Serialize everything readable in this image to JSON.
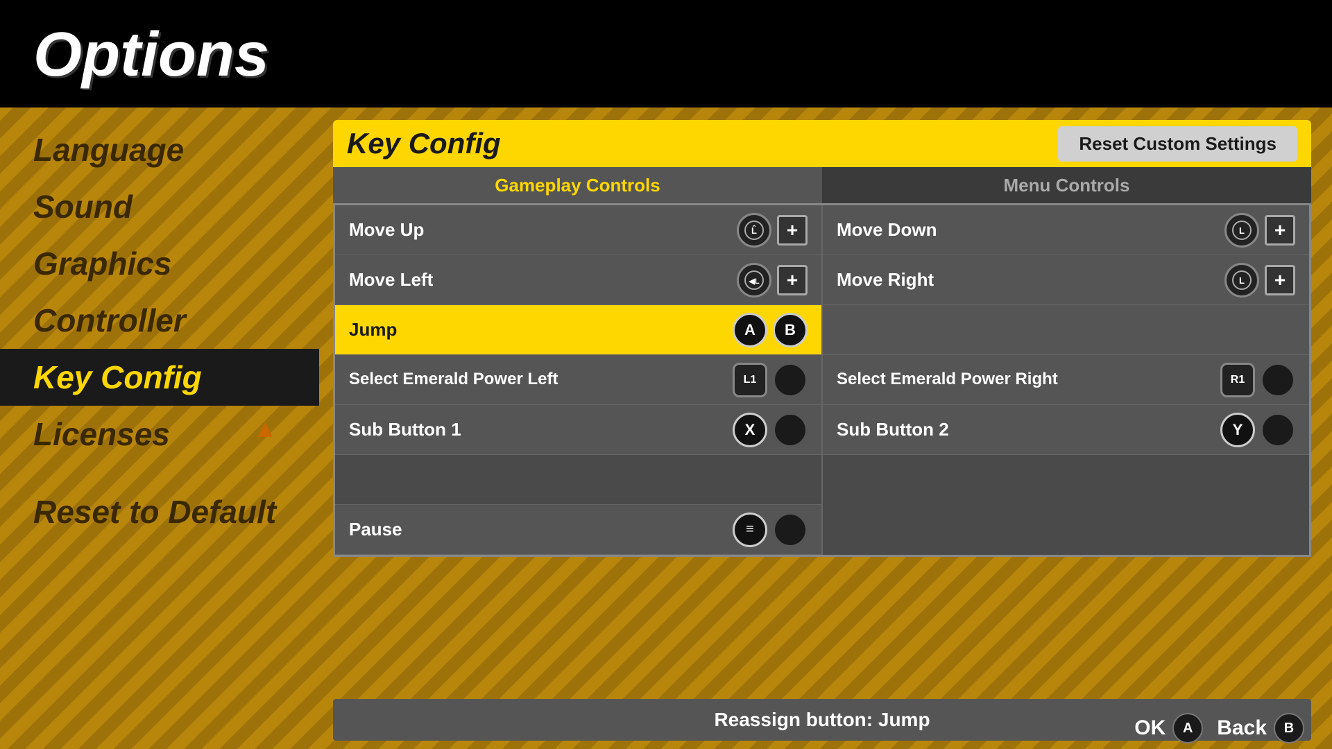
{
  "page": {
    "title": "Options"
  },
  "sidebar": {
    "items": [
      {
        "label": "Language",
        "active": false,
        "id": "language"
      },
      {
        "label": "Sound",
        "active": false,
        "id": "sound"
      },
      {
        "label": "Graphics",
        "active": false,
        "id": "graphics"
      },
      {
        "label": "Controller",
        "active": false,
        "id": "controller"
      },
      {
        "label": "Key Config",
        "active": true,
        "id": "key-config"
      },
      {
        "label": "Licenses",
        "active": false,
        "id": "licenses",
        "triangle": true
      }
    ],
    "reset_label": "Reset to Default"
  },
  "keyconfig": {
    "title": "Key Config",
    "reset_btn": "Reset Custom Settings",
    "tabs": [
      {
        "label": "Gameplay Controls",
        "active": true
      },
      {
        "label": "Menu Controls",
        "active": false
      }
    ],
    "left_column": [
      {
        "label": "Move Up",
        "btn1": "L̂",
        "btn1_type": "stick",
        "btn2": "+",
        "btn2_type": "plus",
        "highlighted": false
      },
      {
        "label": "Move Left",
        "btn1": "◀L",
        "btn1_type": "stick",
        "btn2": "+",
        "btn2_type": "plus",
        "highlighted": false
      },
      {
        "label": "Jump",
        "btn1": "A",
        "btn1_type": "a",
        "btn2": "B",
        "btn2_type": "b",
        "highlighted": true
      },
      {
        "label": "Select Emerald Power Left",
        "btn1": "L1",
        "btn1_type": "l1",
        "btn2": "",
        "btn2_type": "dark",
        "highlighted": false
      },
      {
        "label": "Sub Button 1",
        "btn1": "X",
        "btn1_type": "x",
        "btn2": "",
        "btn2_type": "dark",
        "highlighted": false
      },
      {
        "label": "",
        "empty": true
      },
      {
        "label": "Pause",
        "btn1": "≡",
        "btn1_type": "menu",
        "btn2": "",
        "btn2_type": "dark",
        "highlighted": false
      }
    ],
    "right_column": [
      {
        "label": "Move Down",
        "btn1": "L",
        "btn1_type": "stick",
        "btn2": "+",
        "btn2_type": "plus",
        "highlighted": false
      },
      {
        "label": "Move Right",
        "btn1": "L",
        "btn1_type": "stick",
        "btn2": "+",
        "btn2_type": "plus",
        "highlighted": false
      },
      {
        "label": "",
        "empty": true
      },
      {
        "label": "Select Emerald Power Right",
        "btn1": "R1",
        "btn1_type": "r1",
        "btn2": "",
        "btn2_type": "dark",
        "highlighted": false
      },
      {
        "label": "Sub Button 2",
        "btn1": "Y",
        "btn1_type": "y",
        "btn2": "",
        "btn2_type": "dark",
        "highlighted": false
      }
    ],
    "status_bar": "Reassign button: Jump"
  },
  "bottom_nav": {
    "ok_label": "OK",
    "ok_btn": "A",
    "back_label": "Back",
    "back_btn": "B"
  }
}
